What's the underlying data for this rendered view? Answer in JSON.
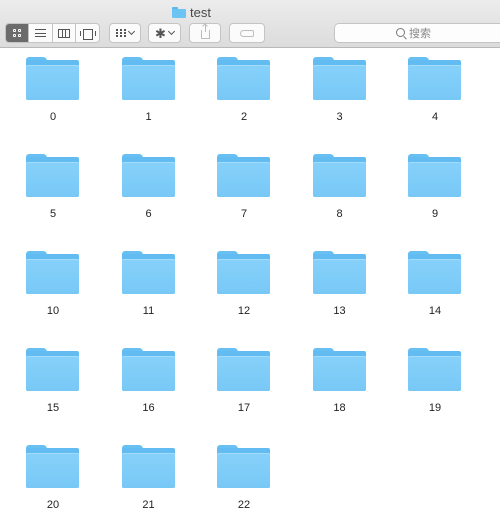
{
  "window": {
    "title": "test"
  },
  "toolbar": {
    "view_buttons": [
      {
        "name": "icon-view",
        "icon": "grid-icon",
        "active": true
      },
      {
        "name": "list-view",
        "icon": "list-icon",
        "active": false
      },
      {
        "name": "column-view",
        "icon": "columns-icon",
        "active": false
      },
      {
        "name": "cover-flow-view",
        "icon": "cover-flow-icon",
        "active": false
      }
    ],
    "group_icon": "group-grid-icon",
    "action_icon": "gear-icon",
    "share_icon": "share-icon",
    "tag_icon": "tag-icon",
    "search_placeholder": "搜索"
  },
  "colors": {
    "folder": "#78c8f6",
    "active_view": "#6b6b6b"
  },
  "items": [
    {
      "name": "0"
    },
    {
      "name": "1"
    },
    {
      "name": "2"
    },
    {
      "name": "3"
    },
    {
      "name": "4"
    },
    {
      "name": "5"
    },
    {
      "name": "6"
    },
    {
      "name": "7"
    },
    {
      "name": "8"
    },
    {
      "name": "9"
    },
    {
      "name": "10"
    },
    {
      "name": "11"
    },
    {
      "name": "12"
    },
    {
      "name": "13"
    },
    {
      "name": "14"
    },
    {
      "name": "15"
    },
    {
      "name": "16"
    },
    {
      "name": "17"
    },
    {
      "name": "18"
    },
    {
      "name": "19"
    },
    {
      "name": "20"
    },
    {
      "name": "21"
    },
    {
      "name": "22"
    }
  ]
}
